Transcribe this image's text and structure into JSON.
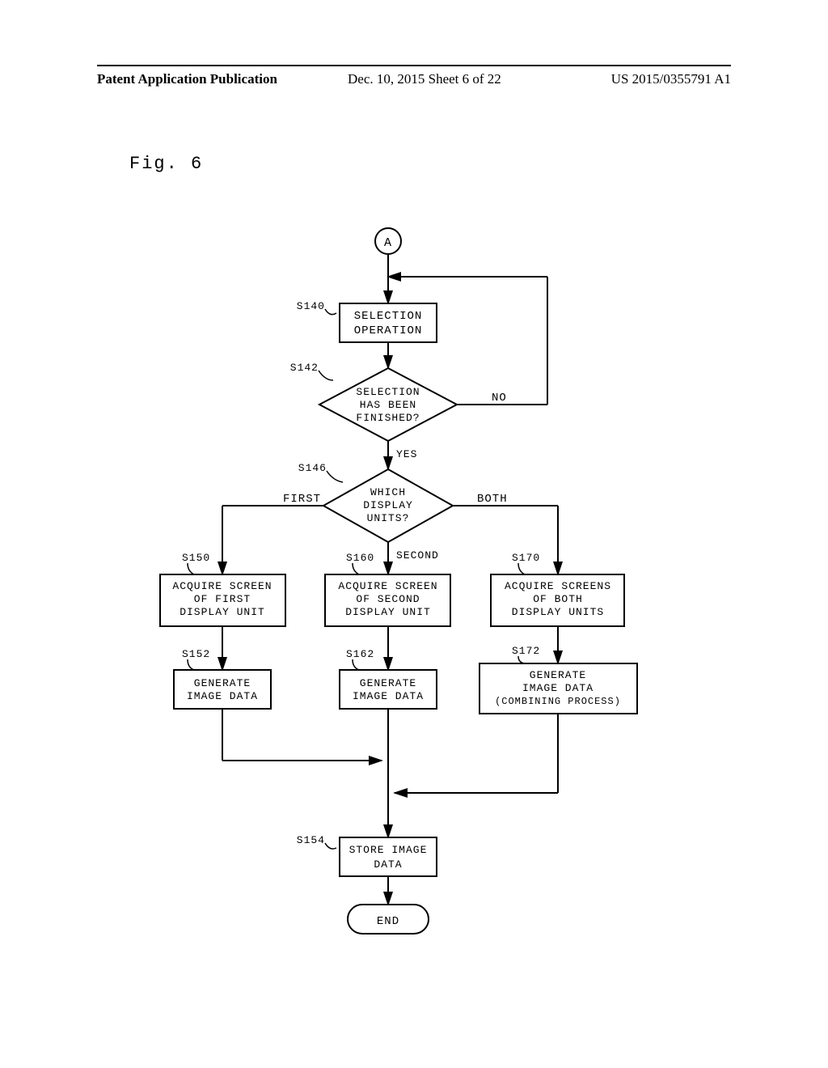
{
  "header": {
    "left": "Patent Application Publication",
    "mid": "Dec. 10, 2015  Sheet 6 of 22",
    "right": "US 2015/0355791 A1"
  },
  "figure_label": "Fig. 6",
  "nodes": {
    "connector_a": "A",
    "s140_label": "S140",
    "s140_text_l1": "SELECTION",
    "s140_text_l2": "OPERATION",
    "s142_label": "S142",
    "s142_text_l1": "SELECTION",
    "s142_text_l2": "HAS BEEN",
    "s142_text_l3": "FINISHED?",
    "s142_no": "NO",
    "s142_yes": "YES",
    "s146_label": "S146",
    "s146_text_l1": "WHICH",
    "s146_text_l2": "DISPLAY",
    "s146_text_l3": "UNITS?",
    "s146_first": "FIRST",
    "s146_second": "SECOND",
    "s146_both": "BOTH",
    "s150_label": "S150",
    "s150_text_l1": "ACQUIRE SCREEN",
    "s150_text_l2": "OF FIRST",
    "s150_text_l3": "DISPLAY UNIT",
    "s160_label": "S160",
    "s160_text_l1": "ACQUIRE SCREEN",
    "s160_text_l2": "OF SECOND",
    "s160_text_l3": "DISPLAY UNIT",
    "s170_label": "S170",
    "s170_text_l1": "ACQUIRE SCREENS",
    "s170_text_l2": "OF BOTH",
    "s170_text_l3": "DISPLAY UNITS",
    "s152_label": "S152",
    "s152_text_l1": "GENERATE",
    "s152_text_l2": "IMAGE DATA",
    "s162_label": "S162",
    "s162_text_l1": "GENERATE",
    "s162_text_l2": "IMAGE DATA",
    "s172_label": "S172",
    "s172_text_l1": "GENERATE",
    "s172_text_l2": "IMAGE DATA",
    "s172_text_l3": "(COMBINING PROCESS)",
    "s154_label": "S154",
    "s154_text_l1": "STORE IMAGE",
    "s154_text_l2": "DATA",
    "end": "END"
  }
}
